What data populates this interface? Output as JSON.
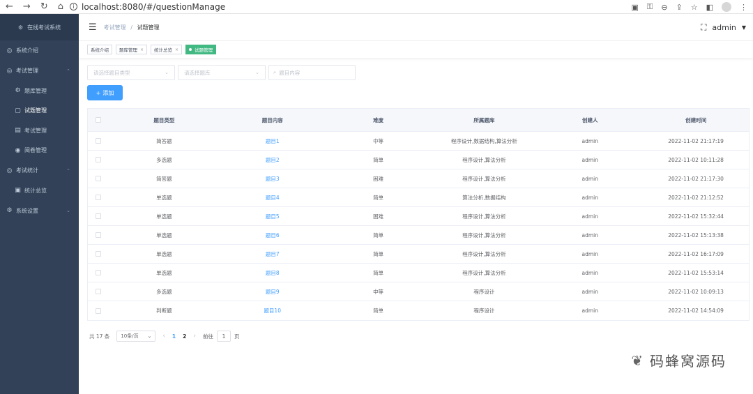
{
  "browser": {
    "back_icon": "←",
    "forward_icon": "→",
    "reload_icon": "↻",
    "home_icon": "⌂",
    "url": "localhost:8080/#/questionManage"
  },
  "sidebar": {
    "brand": "在线考试系统",
    "items": [
      {
        "label": "系统介绍",
        "icon": "◎",
        "level": 1
      },
      {
        "label": "考试管理",
        "icon": "◎",
        "level": 1,
        "caret": "⌃"
      },
      {
        "label": "题库管理",
        "icon": "⚙",
        "level": 2
      },
      {
        "label": "试题管理",
        "icon": "▢",
        "level": 2,
        "active": true
      },
      {
        "label": "考试管理",
        "icon": "▤",
        "level": 2
      },
      {
        "label": "阅卷管理",
        "icon": "◉",
        "level": 2
      },
      {
        "label": "考试统计",
        "icon": "◎",
        "level": 1,
        "caret": "⌃"
      },
      {
        "label": "统计总览",
        "icon": "▣",
        "level": 2
      },
      {
        "label": "系统设置",
        "icon": "⚙",
        "level": 1,
        "caret": "⌄"
      }
    ]
  },
  "header": {
    "breadcrumb": [
      "考试管理",
      "试题管理"
    ],
    "separator": "/",
    "user": "admin"
  },
  "tags": [
    {
      "label": "系统介绍",
      "active": false,
      "closable": false
    },
    {
      "label": "题库管理",
      "active": false,
      "closable": true
    },
    {
      "label": "统计总览",
      "active": false,
      "closable": true
    },
    {
      "label": "试题管理",
      "active": true,
      "closable": false
    }
  ],
  "filters": {
    "type_placeholder": "请选择题目类型",
    "bank_placeholder": "请选择题库",
    "search_placeholder": "题目内容"
  },
  "add_button": "添加",
  "table": {
    "columns": [
      "题目类型",
      "题目内容",
      "难度",
      "所属题库",
      "创建人",
      "创建时间"
    ],
    "rows": [
      [
        "简答题",
        "题目1",
        "中等",
        "程序设计,数据结构,算法分析",
        "admin",
        "2022-11-02 21:17:19"
      ],
      [
        "多选题",
        "题目2",
        "简单",
        "程序设计,算法分析",
        "admin",
        "2022-11-02 10:11:28"
      ],
      [
        "简答题",
        "题目3",
        "困难",
        "程序设计,算法分析",
        "admin",
        "2022-11-02 21:17:30"
      ],
      [
        "单选题",
        "题目4",
        "简单",
        "算法分析,数据结构",
        "admin",
        "2022-11-02 21:12:52"
      ],
      [
        "单选题",
        "题目5",
        "困难",
        "程序设计,算法分析",
        "admin",
        "2022-11-02 15:32:44"
      ],
      [
        "单选题",
        "题目6",
        "简单",
        "程序设计,算法分析",
        "admin",
        "2022-11-02 15:13:38"
      ],
      [
        "单选题",
        "题目7",
        "简单",
        "程序设计,算法分析",
        "admin",
        "2022-11-02 16:17:09"
      ],
      [
        "单选题",
        "题目8",
        "简单",
        "程序设计,算法分析",
        "admin",
        "2022-11-02 15:53:14"
      ],
      [
        "多选题",
        "题目9",
        "中等",
        "程序设计",
        "admin",
        "2022-11-02 10:09:13"
      ],
      [
        "判断题",
        "题目10",
        "简单",
        "程序设计",
        "admin",
        "2022-11-02 14:54:09"
      ]
    ]
  },
  "pagination": {
    "total": "共 17 条",
    "page_size": "10条/页",
    "pages": [
      "1",
      "2"
    ],
    "current": "1",
    "goto_prefix": "前往",
    "goto_value": "1",
    "goto_suffix": "页"
  },
  "watermark": "码蜂窝源码"
}
